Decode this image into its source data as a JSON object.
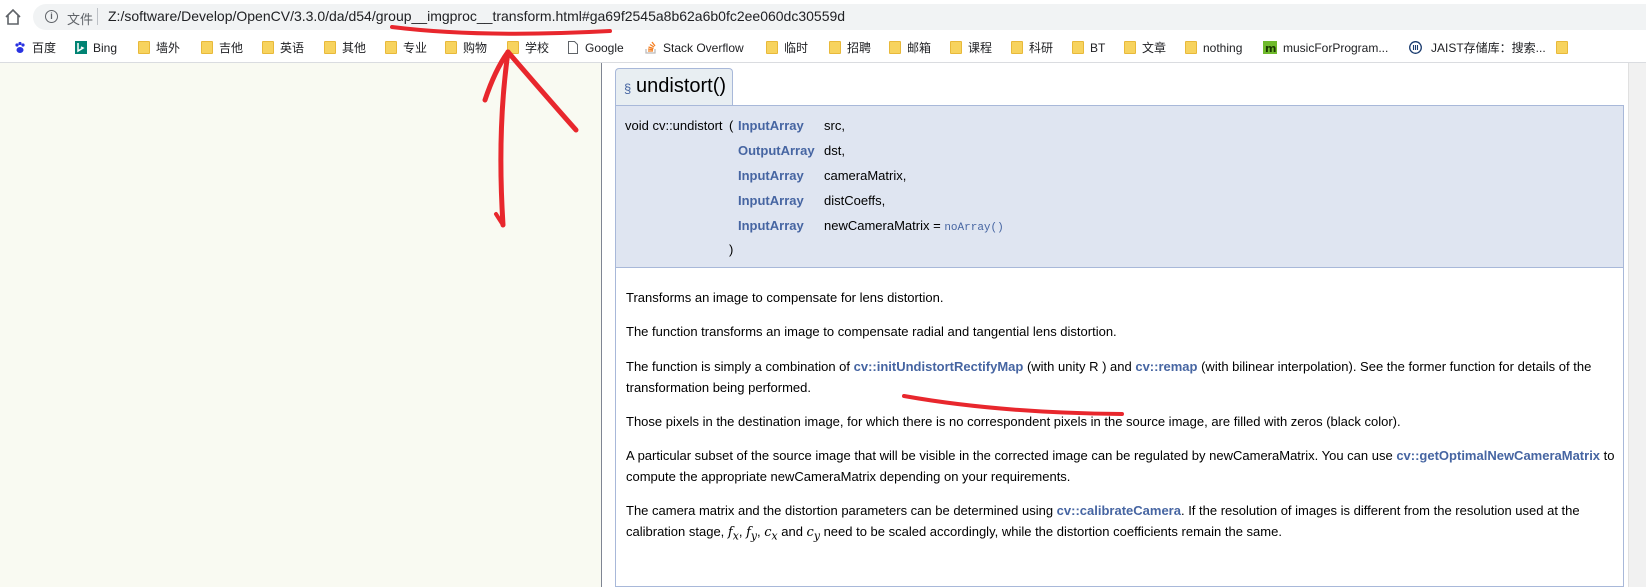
{
  "address_bar": {
    "scheme_label": "文件",
    "url": "Z:/software/Develop/OpenCV/3.3.0/da/d54/group__imgproc__transform.html#ga69f2545a8b62a6b0fc2ee060dc30559d"
  },
  "bookmarks": [
    {
      "label": "百度",
      "icon": "baidu-paw-icon"
    },
    {
      "label": "Bing",
      "icon": "bing-icon"
    },
    {
      "label": "墙外",
      "icon": "folder-icon"
    },
    {
      "label": "吉他",
      "icon": "folder-icon"
    },
    {
      "label": "英语",
      "icon": "folder-icon"
    },
    {
      "label": "其他",
      "icon": "folder-icon"
    },
    {
      "label": "专业",
      "icon": "folder-icon"
    },
    {
      "label": "购物",
      "icon": "folder-icon"
    },
    {
      "label": "学校",
      "icon": "folder-icon"
    },
    {
      "label": "Google",
      "icon": "page-icon"
    },
    {
      "label": "Stack Overflow",
      "icon": "stackoverflow-icon"
    },
    {
      "label": "临时",
      "icon": "folder-icon"
    },
    {
      "label": "招聘",
      "icon": "folder-icon"
    },
    {
      "label": "邮箱",
      "icon": "folder-icon"
    },
    {
      "label": "课程",
      "icon": "folder-icon"
    },
    {
      "label": "科研",
      "icon": "folder-icon"
    },
    {
      "label": "BT",
      "icon": "folder-icon"
    },
    {
      "label": "文章",
      "icon": "folder-icon"
    },
    {
      "label": "nothing",
      "icon": "folder-icon"
    },
    {
      "label": "musicForProgram...",
      "icon": "music-m-icon"
    },
    {
      "label": "JAIST存储库：搜索...",
      "icon": "jaist-icon"
    }
  ],
  "doc": {
    "section_mark": "§",
    "func_title": "undistort()",
    "signature": {
      "prefix": "void cv::undistort",
      "open_paren": "(",
      "close_paren": ")",
      "params": [
        {
          "type": "InputArray",
          "name": "src,"
        },
        {
          "type": "OutputArray",
          "name": "dst,"
        },
        {
          "type": "InputArray",
          "name": "cameraMatrix,"
        },
        {
          "type": "InputArray",
          "name": "distCoeffs,"
        },
        {
          "type": "InputArray",
          "name": "newCameraMatrix",
          "default_eq": " = ",
          "default": "noArray()"
        }
      ]
    },
    "p1": "Transforms an image to compensate for lens distortion.",
    "p2": "The function transforms an image to compensate radial and tangential lens distortion.",
    "p3": {
      "a": "The function is simply a combination of ",
      "link1": "cv::initUndistortRectifyMap",
      "b": " (with unity R ) and ",
      "link2": "cv::remap",
      "c": " (with bilinear interpolation). See the former function for details of the transformation being performed."
    },
    "p4": "Those pixels in the destination image, for which there is no correspondent pixels in the source image, are filled with zeros (black color).",
    "p5": {
      "a": "A particular subset of the source image that will be visible in the corrected image can be regulated by newCameraMatrix. You can use ",
      "link": "cv::getOptimalNewCameraMatrix",
      "b": " to compute the appropriate newCameraMatrix depending on your requirements."
    },
    "p6": {
      "a": "The camera matrix and the distortion parameters can be determined using ",
      "link": "cv::calibrateCamera",
      "b": ". If the resolution of images is different from the resolution used at the calibration stage, ",
      "math1": "f",
      "math1_sub": "x",
      "comma": ", ",
      "math2": "f",
      "math2_sub": "y",
      "math3": "c",
      "math3_sub": "x",
      "and": " and ",
      "math4": "c",
      "math4_sub": "y",
      "c": " need to be scaled accordingly, while the distortion coefficients remain the same."
    }
  },
  "annotation_color": "#e8272d"
}
